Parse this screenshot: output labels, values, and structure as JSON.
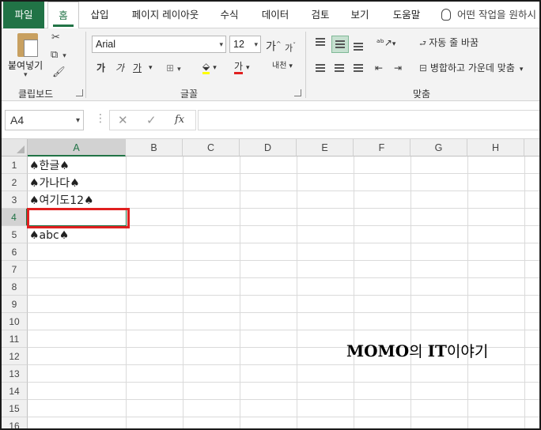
{
  "tabs": {
    "file": "파일",
    "home": "홈",
    "items": [
      {
        "label": "삽입"
      },
      {
        "label": "페이지 레이아웃"
      },
      {
        "label": "수식"
      },
      {
        "label": "데이터"
      },
      {
        "label": "검토"
      },
      {
        "label": "보기"
      },
      {
        "label": "도움말"
      }
    ],
    "search": "어떤 작업을 원하시"
  },
  "ribbon": {
    "clipboard": {
      "paste_label": "붙여넣기",
      "group_label": "클립보드"
    },
    "font": {
      "font_name": "Arial",
      "font_size": "12",
      "grow_label": "가",
      "shrink_label": "가",
      "bold_label": "가",
      "italic_label": "가",
      "underline_label": "가",
      "font_color_label": "가",
      "phonetic_label": "내천",
      "group_label": "글꼴"
    },
    "alignment": {
      "wrap_label": "자동 줄 바꿈",
      "merge_label": "병합하고 가운데 맞춤",
      "group_label": "맞춤"
    }
  },
  "formula_bar": {
    "name_box": "A4",
    "fx_label": "fx",
    "value": ""
  },
  "sheet": {
    "columns": [
      "A",
      "B",
      "C",
      "D",
      "E",
      "F",
      "G",
      "H"
    ],
    "selected_column": "A",
    "rows": [
      "1",
      "2",
      "3",
      "4",
      "5",
      "6",
      "7",
      "8",
      "9",
      "10",
      "11",
      "12",
      "13",
      "14",
      "15",
      "16"
    ],
    "selected_row": "4",
    "cells": {
      "A1": "♠한글♠",
      "A2": "♠가나다♠",
      "A3": "♠여기도12♠",
      "A4": "",
      "A5": "♠abc♠"
    },
    "selection_color": "#e02020",
    "accent_color": "#217346"
  },
  "watermark": {
    "latin1": "MOMO",
    "korean1": "의 ",
    "latin2": "IT",
    "korean2": "이야기"
  }
}
